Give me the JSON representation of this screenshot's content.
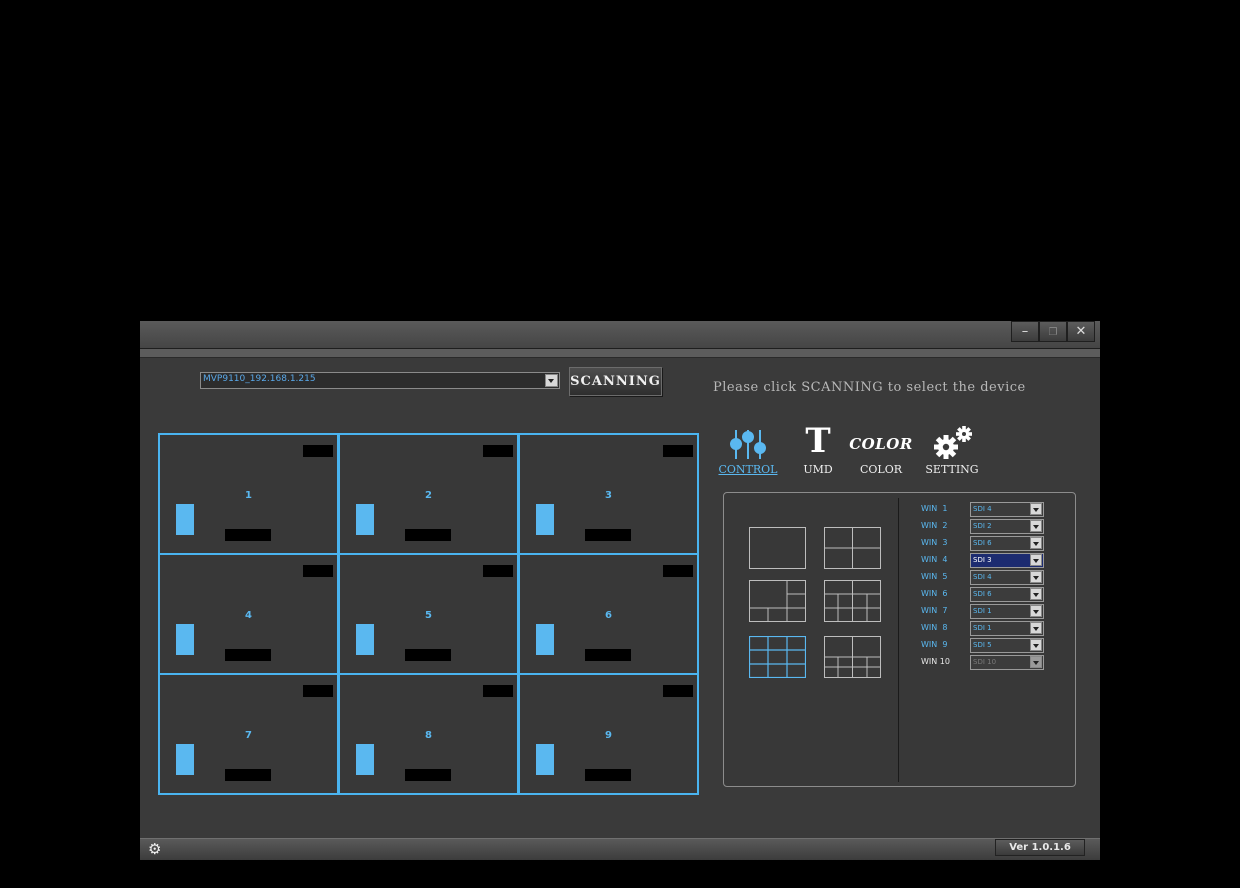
{
  "window": {
    "minimize_glyph": "–",
    "restore_glyph": "❐",
    "close_glyph": "✕"
  },
  "toolbar": {
    "device_value": "MVP9110_192.168.1.215",
    "scan_label": "SCANNING",
    "hint": "Please click SCANNING to select the device"
  },
  "preview": {
    "cells": [
      "1",
      "2",
      "3",
      "4",
      "5",
      "6",
      "7",
      "8",
      "9"
    ]
  },
  "tabs": {
    "control": "CONTROL",
    "umd": "UMD",
    "umd_glyph": "T",
    "color": "COLOR",
    "color_glyph": "COLOR",
    "setting": "SETTING",
    "active": "control"
  },
  "layouts": [
    {
      "icon": "layout-single-icon"
    },
    {
      "icon": "layout-quad-icon"
    },
    {
      "icon": "layout-1plus5-icon"
    },
    {
      "icon": "layout-10-icon"
    },
    {
      "icon": "layout-3x3-icon",
      "selected": true
    },
    {
      "icon": "layout-1plus8-icon"
    }
  ],
  "windows": [
    {
      "label": "WIN  1",
      "source": "SDI 4"
    },
    {
      "label": "WIN  2",
      "source": "SDI 2"
    },
    {
      "label": "WIN  3",
      "source": "SDI 6"
    },
    {
      "label": "WIN  4",
      "source": "SDI 3"
    },
    {
      "label": "WIN  5",
      "source": "SDI 4"
    },
    {
      "label": "WIN  6",
      "source": "SDI 6"
    },
    {
      "label": "WIN  7",
      "source": "SDI 1"
    },
    {
      "label": "WIN  8",
      "source": "SDI 1"
    },
    {
      "label": "WIN  9",
      "source": "SDI 5"
    },
    {
      "label": "WIN 10",
      "source": "SDI 10"
    }
  ],
  "footer": {
    "version": "Ver 1.0.1.6"
  },
  "colors": {
    "accent": "#4ab4f0",
    "background": "#3a3a3a"
  }
}
